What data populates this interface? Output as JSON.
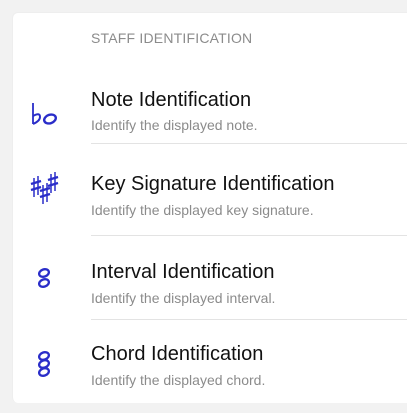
{
  "section_header": "STAFF IDENTIFICATION",
  "accent_color": "#2a2dc9",
  "items": [
    {
      "title": "Note Identification",
      "subtitle": "Identify the displayed note.",
      "icon": "flat-note-icon"
    },
    {
      "title": "Key Signature Identification",
      "subtitle": "Identify the displayed key signature.",
      "icon": "sharps-key-signature-icon"
    },
    {
      "title": "Interval Identification",
      "subtitle": "Identify the displayed interval.",
      "icon": "interval-notes-icon"
    },
    {
      "title": "Chord Identification",
      "subtitle": "Identify the displayed chord.",
      "icon": "chord-notes-icon"
    }
  ]
}
